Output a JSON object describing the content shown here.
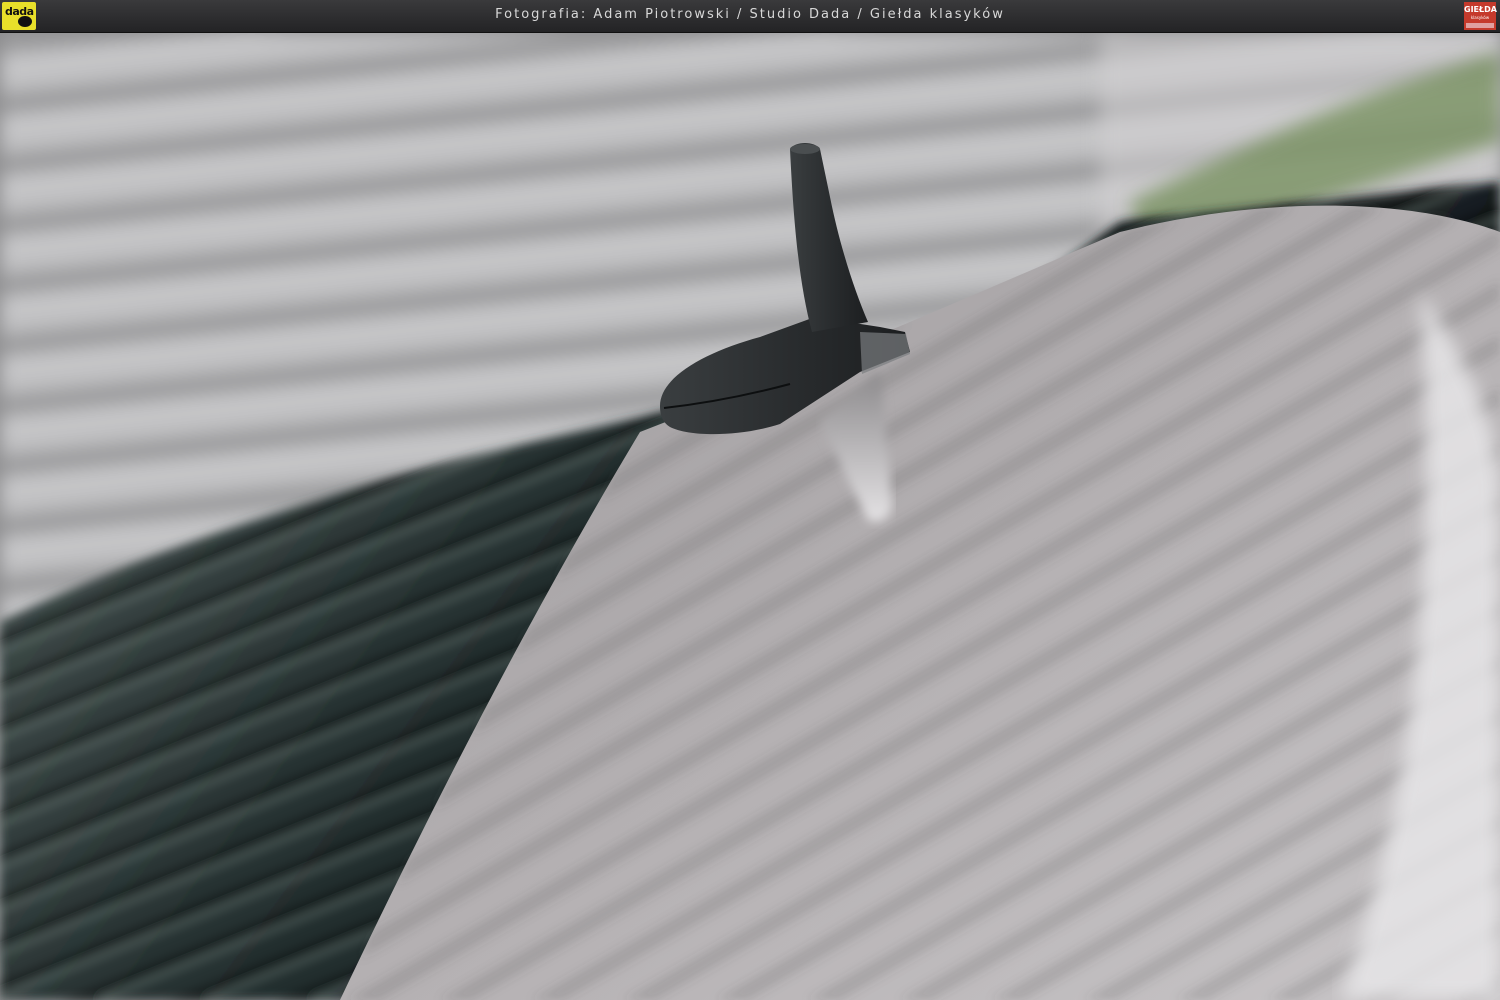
{
  "caption": "Fotografia: Adam Piotrowski / Studio Dada / Giełda klasyków",
  "logos": {
    "left": "dada",
    "right": "GIEŁDA",
    "right_sub": "klasyków"
  },
  "photo": {
    "subject": "car-roof-antenna",
    "colors": {
      "wall": "#b5b5b7",
      "roof_dark": "#1f2324",
      "roof_light": "#a9a6a8",
      "antenna": "#2e3133",
      "accent_green": "#6e8a52"
    }
  }
}
